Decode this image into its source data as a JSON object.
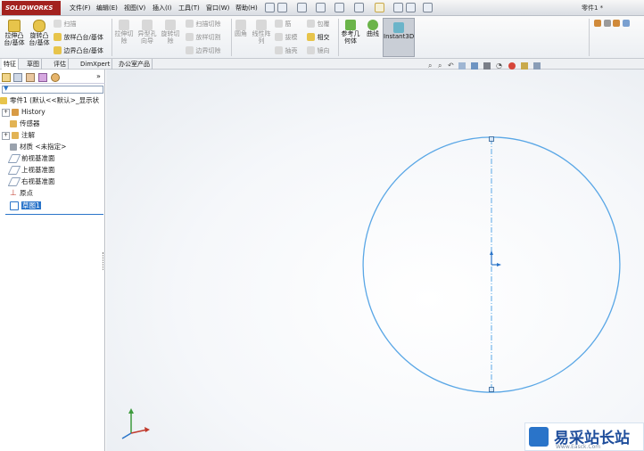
{
  "app": {
    "logo_text": "SOLIDWORKS",
    "document_title": "零件1 *",
    "accent_color": "#2a74c9",
    "sketch_color": "#5aa7e6"
  },
  "menu": [
    "文件(F)",
    "编辑(E)",
    "视图(V)",
    "插入(I)",
    "工具(T)",
    "窗口(W)",
    "帮助(H)"
  ],
  "command_manager": {
    "extrude_boss": "拉伸凸台/基体",
    "revolve_boss": "旋转凸台/基体",
    "sweep": "扫描",
    "loft": "放样凸台/基体",
    "boundary": "边界凸台/基体",
    "extrude_cut": "拉伸切除",
    "hole_wizard": "异型孔向导",
    "revolve_cut": "旋转切除",
    "swept_cut": "扫描切除",
    "lofted_cut": "放样切割",
    "boundary_cut": "边界切除",
    "fillet": "圆角",
    "linear_pattern": "线性阵列",
    "rib": "筋",
    "draft": "拔模",
    "shell": "抽壳",
    "wrap": "包覆",
    "intersect": "相交",
    "mirror": "镜向",
    "ref_geometry": "参考几何体",
    "curves": "曲线",
    "instant3d": "Instant3D"
  },
  "tabs": [
    "特征",
    "草图",
    "评估",
    "DimXpert",
    "办公室产品"
  ],
  "tree": {
    "root": "零件1 (默认<<默认>_显示状",
    "items": [
      "History",
      "传感器",
      "注解",
      "材质 <未指定>",
      "前视基准面",
      "上视基准面",
      "右视基准面",
      "原点",
      "草图1"
    ]
  },
  "watermark": {
    "text": "易采站长站",
    "url": "Www.Easck.Com"
  }
}
